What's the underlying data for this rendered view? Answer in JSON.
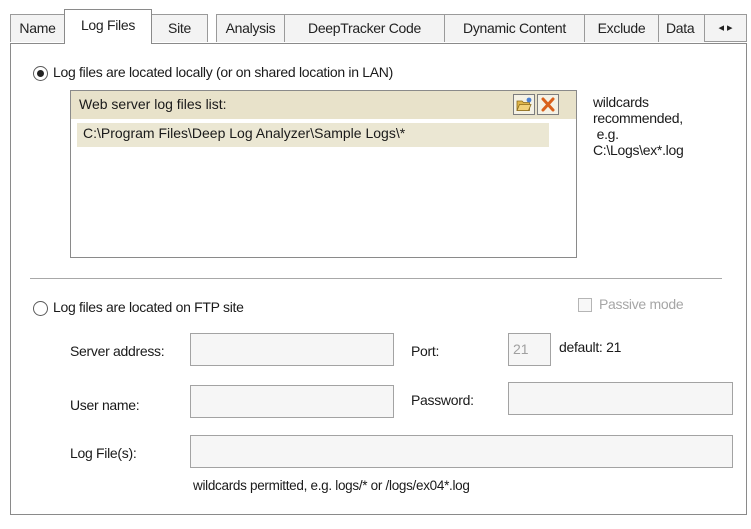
{
  "tabs": [
    {
      "label": "Name",
      "active": false
    },
    {
      "label": "Log Files",
      "active": true
    },
    {
      "label": "Site",
      "active": false
    },
    {
      "label": "Analysis",
      "active": false
    },
    {
      "label": "DeepTracker Code",
      "active": false
    },
    {
      "label": "Dynamic Content",
      "active": false
    },
    {
      "label": "Exclude",
      "active": false
    },
    {
      "label": "Data",
      "active": false
    }
  ],
  "tab_scroll": {
    "left": "◂",
    "right": "▸"
  },
  "local": {
    "radio_label": "Log files are located locally (or on shared location in LAN)",
    "list_header": "Web server log files list:",
    "items": [
      "C:\\Program Files\\Deep Log Analyzer\\Sample Logs\\*"
    ],
    "hint_lines": [
      "wildcards",
      "recommended,",
      " e.g.",
      "C:\\Logs\\ex*.log"
    ],
    "add_icon": "folder-open-icon",
    "remove_icon": "delete-x-icon"
  },
  "ftp": {
    "radio_label": "Log files are located on FTP site",
    "passive_label": "Passive mode",
    "server_label": "Server address:",
    "server_value": "",
    "port_label": "Port:",
    "port_value": "21",
    "port_default": "default: 21",
    "user_label": "User name:",
    "user_value": "",
    "password_label": "Password:",
    "password_value": "",
    "logfile_label": "Log File(s):",
    "logfile_value": "",
    "logfile_hint": "wildcards permitted, e.g. logs/* or /logs/ex04*.log"
  },
  "colors": {
    "list_header_bg": "#e8e2ca",
    "selected_row_bg": "#ebe7d3"
  }
}
